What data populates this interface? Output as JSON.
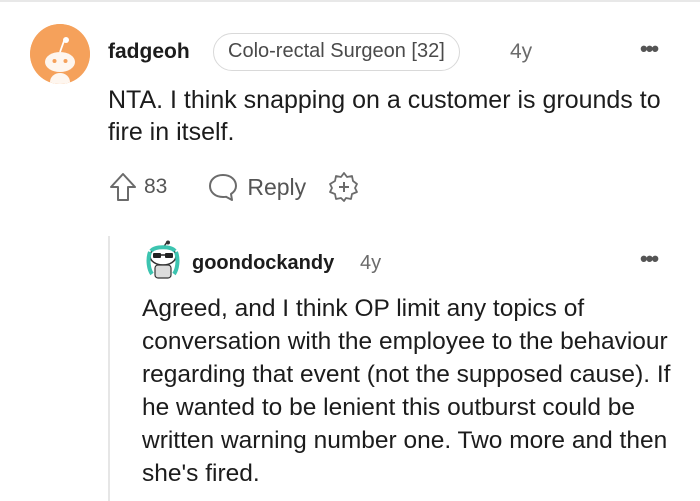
{
  "comment": {
    "author": "fadgeoh",
    "flair": "Colo-rectal Surgeon [32]",
    "time": "4y",
    "more": "•••",
    "body": "NTA. I think snapping on a customer is grounds to fire in itself.",
    "votes": "83",
    "reply_label": "Reply"
  },
  "reply": {
    "author": "goondockandy",
    "time": "4y",
    "more": "•••",
    "body": "Agreed, and I think OP limit any topics of conversation with the employee to the behaviour regarding that event (not the supposed cause). If he wanted to be lenient this outburst could be written warning number one. Two more and then she's fired."
  },
  "icons": {
    "upvote": "upvote-arrow-icon",
    "reply": "speech-bubble-icon",
    "award": "award-plus-icon",
    "avatar_color": "#f5a15b"
  }
}
